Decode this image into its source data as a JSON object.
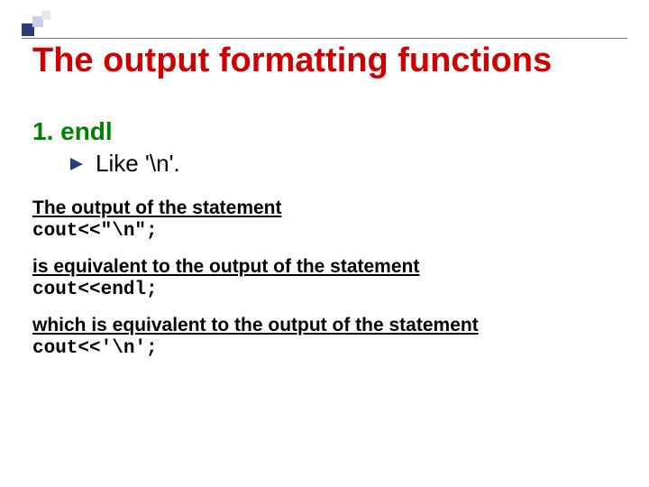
{
  "title": "The output formatting functions",
  "list": {
    "num": "1. endl",
    "bullet": "Like '\\n'."
  },
  "p1": "The output of the statement",
  "c1": "cout<<\"\\n\";",
  "p2": "is equivalent to the output of the statement",
  "c2": "cout<<endl;",
  "p3": "which is equivalent to the output of the statement",
  "c3": "cout<<'\\n';"
}
